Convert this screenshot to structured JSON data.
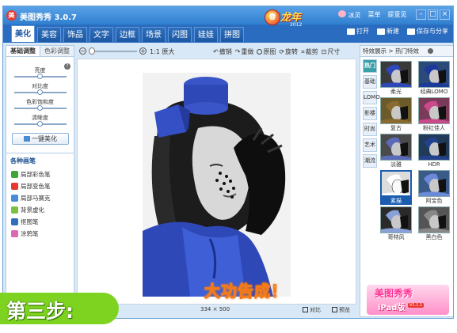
{
  "app": {
    "title": "美图秀秀 3.0.7",
    "logo_glyph": "美"
  },
  "event_badge": {
    "text": "龙年",
    "year": "2012",
    "ball": "春"
  },
  "user": {
    "name": "冰灵",
    "menu": "菜单",
    "feedback": "提意见"
  },
  "tabs": [
    "美化",
    "美容",
    "饰品",
    "文字",
    "边框",
    "场景",
    "闪图",
    "娃娃",
    "拼图"
  ],
  "active_tab": "美化",
  "toolbar": {
    "open": "打开",
    "new": "新建",
    "save_share": "保存与分享"
  },
  "left_panel": {
    "sub_tabs": [
      "基础调整",
      "色彩调整"
    ],
    "sliders": [
      {
        "label": "亮度",
        "value": 0.5
      },
      {
        "label": "对比度",
        "value": 0.5
      },
      {
        "label": "色彩饱和度",
        "value": 0.5
      },
      {
        "label": "清晰度",
        "value": 0.5
      }
    ],
    "one_click": "一键美化",
    "brush_title": "各种画笔",
    "brushes": [
      "局部彩色笔",
      "局部变色笔",
      "局部马赛克",
      "背景虚化",
      "抠图笔",
      "涂鸦笔"
    ],
    "brush_colors": [
      "#3fa535",
      "#e8382f",
      "#4a8bd8",
      "#7ac142",
      "#2f6fbb",
      "#d96bb0"
    ]
  },
  "canvas_toolbar": {
    "original_size": "1:1 原大",
    "actions": [
      "撤销",
      "重做",
      "原图",
      "旋转",
      "裁剪",
      "尺寸"
    ]
  },
  "canvas": {
    "headline": "大功告成！"
  },
  "status": {
    "width": "334",
    "times": "×",
    "height": "500",
    "compare": "对比",
    "preview": "预览"
  },
  "step_banner": "第三步:",
  "right_panel": {
    "header": "特效展示 > 热门特效",
    "categories": [
      "热门",
      "基础",
      "LOMO",
      "影楼",
      "时尚",
      "艺术",
      "潮流"
    ],
    "active_category": "热门",
    "effects": [
      "柔光",
      "经典LOMO",
      "复古",
      "粉红佳人",
      "淡雅",
      "HDR",
      "素描",
      "阿宝色",
      "哥特风",
      "黑白色"
    ],
    "selected_effect": "素描",
    "ad": {
      "title": "美图秀秀",
      "subtitle": "iPad版",
      "version": "V1.1.1"
    }
  }
}
